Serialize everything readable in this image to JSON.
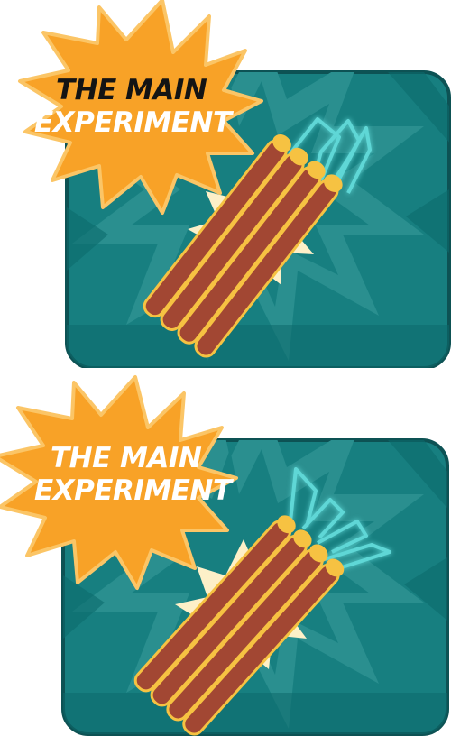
{
  "colors": {
    "card_fill": "#177f80",
    "card_star": "#2a8f8f",
    "card_dark": "#0c6a6c",
    "card_border": "#0d5254",
    "burst_fill": "#f8a227",
    "burst_stroke": "#fbc566",
    "glow_star": "#fdf0c8",
    "dynamite_fill": "#a24733",
    "dynamite_stroke": "#f6c242",
    "fuse_glow": "#5fd7d6",
    "title_top_1": "#141414",
    "title_bottom_1": "#ffffff",
    "title_2": "#ffffff"
  },
  "panels": [
    {
      "id": "panel-1",
      "title_line1": "THE MAIN",
      "title_line2": "EXPERIMENT",
      "title_line1_color": "#141414",
      "fuse_state": "lit-sparks",
      "icon": "dynamite-icon"
    },
    {
      "id": "panel-2",
      "title_line1": "THE MAIN",
      "title_line2": "EXPERIMENT",
      "title_line1_color": "#ffffff",
      "fuse_state": "lit-sparks-large",
      "icon": "dynamite-icon"
    }
  ]
}
